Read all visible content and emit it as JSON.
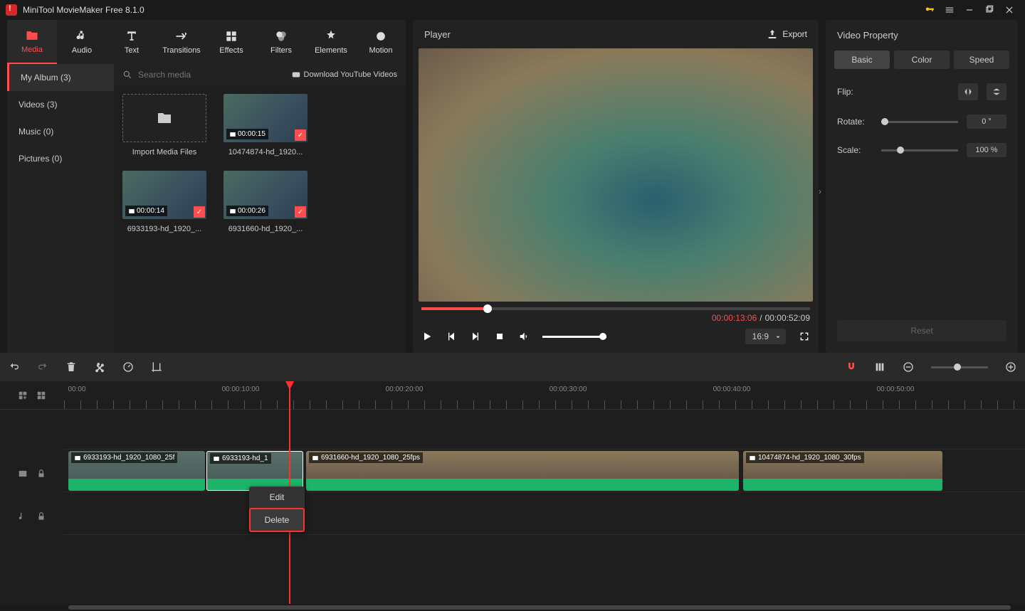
{
  "app": {
    "title": "MiniTool MovieMaker Free 8.1.0"
  },
  "tabs": {
    "media": "Media",
    "audio": "Audio",
    "text": "Text",
    "transitions": "Transitions",
    "effects": "Effects",
    "filters": "Filters",
    "elements": "Elements",
    "motion": "Motion"
  },
  "sidebar": {
    "album": "My Album (3)",
    "videos": "Videos (3)",
    "music": "Music (0)",
    "pictures": "Pictures (0)"
  },
  "mediaHeader": {
    "searchPlaceholder": "Search media",
    "download": "Download YouTube Videos"
  },
  "mediaItems": {
    "import": "Import Media Files",
    "m1": {
      "dur": "00:00:15",
      "name": "10474874-hd_1920..."
    },
    "m2": {
      "dur": "00:00:14",
      "name": "6933193-hd_1920_..."
    },
    "m3": {
      "dur": "00:00:26",
      "name": "6931660-hd_1920_..."
    }
  },
  "player": {
    "title": "Player",
    "export": "Export",
    "current": "00:00:13:06",
    "total": "00:00:52:09",
    "ratio": "16:9"
  },
  "props": {
    "title": "Video Property",
    "tabs": {
      "basic": "Basic",
      "color": "Color",
      "speed": "Speed"
    },
    "flip": "Flip:",
    "rotate": "Rotate:",
    "scale": "Scale:",
    "rotateVal": "0 °",
    "scaleVal": "100 %",
    "reset": "Reset"
  },
  "ruler": {
    "t0": "00:00",
    "t1": "00:00:10:00",
    "t2": "00:00:20:00",
    "t3": "00:00:30:00",
    "t4": "00:00:40:00",
    "t5": "00:00:50:00"
  },
  "clips": {
    "c1": "6933193-hd_1920_1080_25f",
    "c2": "6933193-hd_1",
    "c3": "6931660-hd_1920_1080_25fps",
    "c4": "10474874-hd_1920_1080_30fps"
  },
  "ctx": {
    "edit": "Edit",
    "delete": "Delete"
  }
}
